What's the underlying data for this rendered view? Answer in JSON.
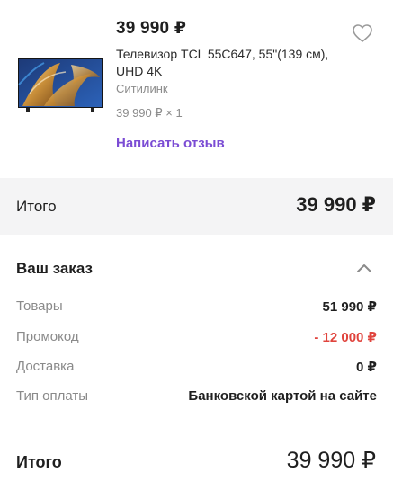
{
  "product": {
    "price": "39 990 ₽",
    "title": "Телевизор TCL 55C647, 55\"(139 см), UHD 4K",
    "seller": "Ситилинк",
    "qty_line": "39 990 ₽ × 1",
    "review_label": "Написать отзыв",
    "favorite_icon": "heart-outline-icon",
    "image": "tv-product-image"
  },
  "total": {
    "label": "Итого",
    "value": "39 990 ₽"
  },
  "order": {
    "title": "Ваш заказ",
    "collapse_icon": "chevron-up-icon",
    "rows": [
      {
        "label": "Товары",
        "value": "51 990 ₽"
      },
      {
        "label": "Промокод",
        "value": "- 12 000 ₽"
      },
      {
        "label": "Доставка",
        "value": "0 ₽"
      },
      {
        "label": "Тип оплаты",
        "value": "Банковской картой на сайте"
      }
    ]
  },
  "grand_total": {
    "label": "Итого",
    "value": "39 990 ₽"
  },
  "colors": {
    "accent": "#7b4cd4",
    "discount": "#e0443d",
    "band": "#f4f4f5"
  }
}
